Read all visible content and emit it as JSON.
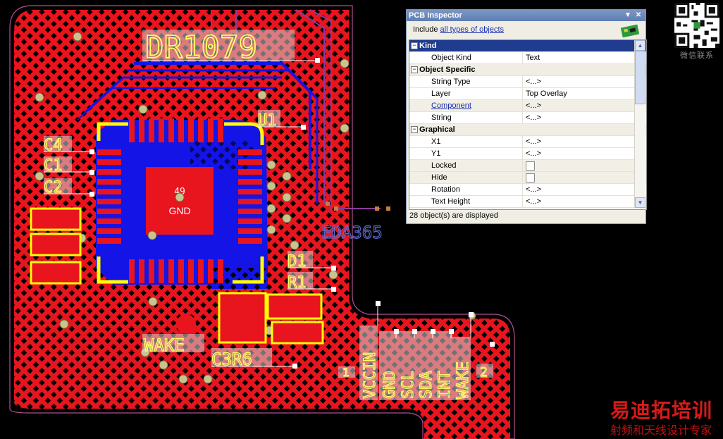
{
  "pcb": {
    "designator_big": "DR1079",
    "labels": [
      "U1",
      "C4",
      "C1",
      "C2",
      "D1",
      "R1",
      "WAKE",
      "C3R6",
      "EDA365",
      "1",
      "2"
    ],
    "pad_number": "49",
    "pad_net": "GND",
    "header_pins": [
      "VCCIN",
      "GND",
      "SCL",
      "SDA",
      "INT",
      "WAKE"
    ]
  },
  "inspector": {
    "title": "PCB Inspector",
    "include_prefix": "Include",
    "include_link": "all types of objects",
    "categories": [
      {
        "label": "Kind",
        "selected": true,
        "rows": [
          {
            "name": "Object Kind",
            "value": "Text"
          }
        ]
      },
      {
        "label": "Object Specific",
        "rows": [
          {
            "name": "String Type",
            "value": "<...>"
          },
          {
            "name": "Layer",
            "value": "Top Overlay"
          },
          {
            "name": "Component",
            "value": "<...>",
            "link": true
          },
          {
            "name": "String",
            "value": "<...>"
          }
        ]
      },
      {
        "label": "Graphical",
        "rows": [
          {
            "name": "X1",
            "value": "<...>"
          },
          {
            "name": "Y1",
            "value": "<...>"
          },
          {
            "name": "Locked",
            "value": "",
            "checkbox": true
          },
          {
            "name": "Hide",
            "value": "",
            "checkbox": true
          },
          {
            "name": "Rotation",
            "value": "<...>"
          },
          {
            "name": "Text Height",
            "value": "<...>"
          }
        ]
      }
    ],
    "status": "28 object(s) are displayed"
  },
  "watermark": {
    "qr_caption": "微信联系",
    "brand": "易迪拓培训",
    "tagline": "射频和天线设计专家"
  },
  "colors": {
    "copper": "#e8141e",
    "bottom": "#1414e6",
    "silk": "#ffff66",
    "background": "#000000"
  }
}
